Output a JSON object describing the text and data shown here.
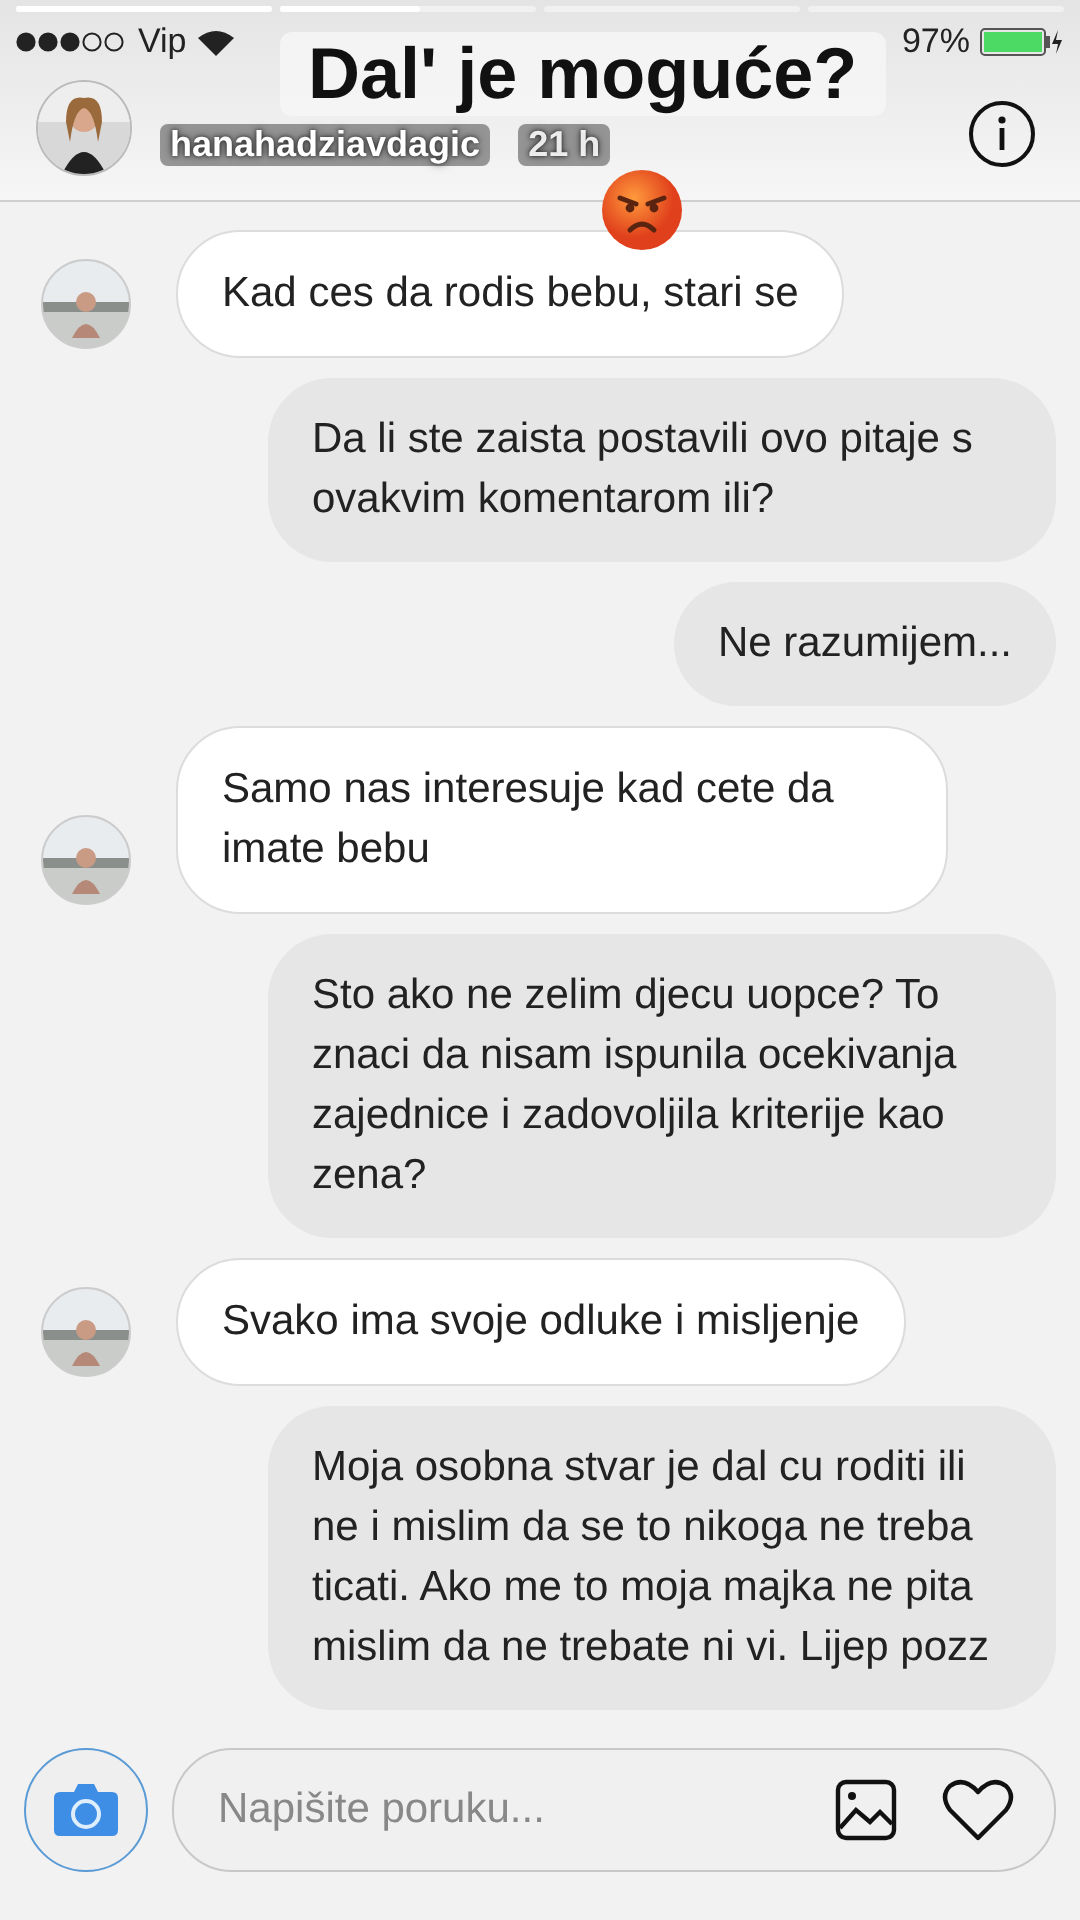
{
  "status_bar": {
    "carrier": "Vip",
    "battery": "97%"
  },
  "story_progress": [
    {
      "level": 1
    },
    {
      "level": 0.55
    }
  ],
  "story_header": {
    "username": "hanahadziavdagic",
    "time": "21 h"
  },
  "caption": "Dal' je moguće?",
  "messages": [
    {
      "kind": "received",
      "text": "Kad ces da rodis bebu, stari se"
    },
    {
      "kind": "sent",
      "text": "Da li ste zaista postavili ovo pitaje s ovakvim komentarom ili?"
    },
    {
      "kind": "sent",
      "text": "Ne razumijem..."
    },
    {
      "kind": "received",
      "text": "Samo nas interesuje kad cete da imate bebu"
    },
    {
      "kind": "sent",
      "text": "Sto ako ne zelim djecu uopce? To znaci da nisam ispunila ocekivanja zajednice i zadovoljila kriterije kao zena?"
    },
    {
      "kind": "received",
      "text": "Svako ima svoje odluke i misljenje"
    },
    {
      "kind": "sent",
      "text": "Moja osobna stvar je dal cu roditi ili ne i mislim da se to nikoga ne treba ticati. Ako me to moja majka ne pita mislim da ne trebate ni vi. Lijep pozz"
    }
  ],
  "composer": {
    "placeholder": "Napišite poruku..."
  }
}
